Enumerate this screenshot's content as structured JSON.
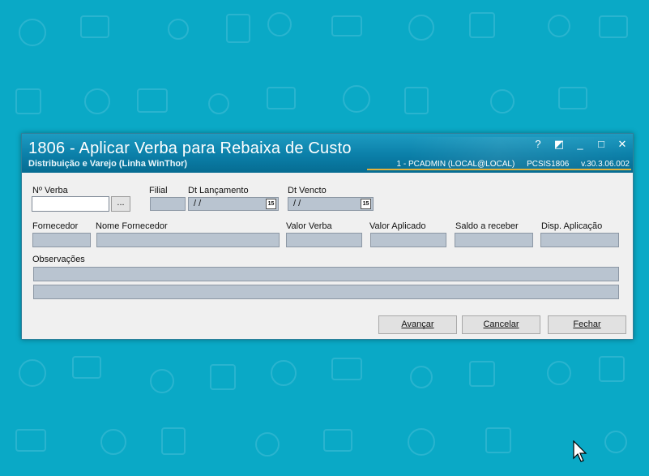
{
  "window": {
    "title": "1806 - Aplicar Verba para Rebaixa de Custo",
    "subtitle": "Distribuição e Varejo (Linha WinThor)",
    "user_info": "1 - PCADMIN (LOCAL@LOCAL)",
    "routine": "PCSIS1806",
    "version": "v.30.3.06.002",
    "controls": {
      "help": "?",
      "restore": "◩",
      "minimize": "_",
      "maximize": "□",
      "close": "✕"
    }
  },
  "form": {
    "n_verba_label": "Nº Verba",
    "n_verba_value": "",
    "search_button": "...",
    "filial_label": "Filial",
    "dt_lancamento_label": "Dt Lançamento",
    "dt_lancamento_value": "/ /",
    "dt_vencto_label": "Dt Vencto",
    "dt_vencto_value": "/ /",
    "calendar_glyph": "15",
    "fornecedor_label": "Fornecedor",
    "nome_fornecedor_label": "Nome Fornecedor",
    "valor_verba_label": "Valor Verba",
    "valor_aplicado_label": "Valor Aplicado",
    "saldo_label": "Saldo a receber",
    "disp_aplicacao_label": "Disp. Aplicação",
    "observacoes_label": "Observações"
  },
  "buttons": {
    "avancar": "Avançar",
    "cancelar": "Cancelar",
    "fechar": "Fechar"
  },
  "colors": {
    "desktop": "#0aa9c6",
    "titlebar": "#0b7fa8",
    "accent_line": "#e3b33c",
    "readonly_field": "#b9c4d0"
  }
}
